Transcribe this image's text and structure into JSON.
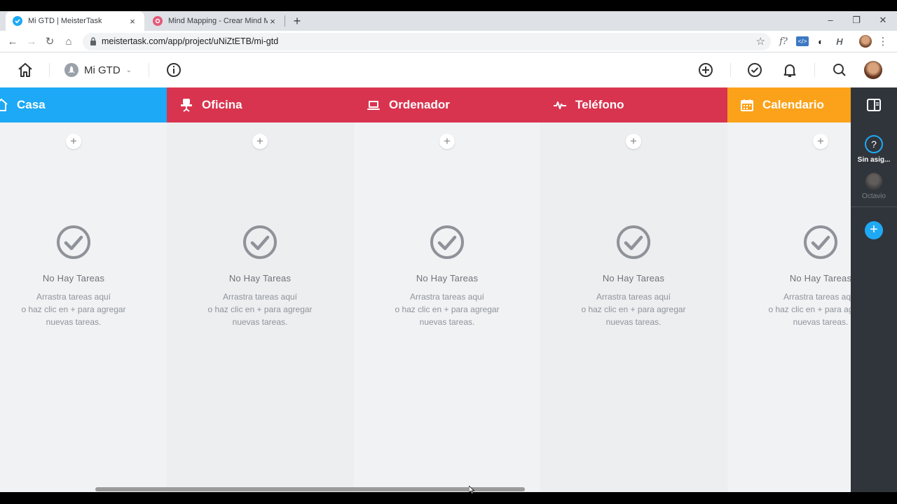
{
  "browser": {
    "tabs": [
      {
        "title": "Mi GTD | MeisterTask",
        "close": "×",
        "favicon_color": "#1fa9f4"
      },
      {
        "title": "Mind Mapping - Crear Mind Map",
        "close": "×",
        "favicon_color": "#e35a7a"
      }
    ],
    "new_tab": "+",
    "window_controls": {
      "minimize": "–",
      "maximize": "❐",
      "close": "✕"
    },
    "nav": {
      "back": "←",
      "forward": "→",
      "reload": "↻",
      "home": "⌂"
    },
    "url": "meistertask.com/app/project/uNiZtETB/mi-gtd",
    "star": "☆",
    "extensions": {
      "formula": "f?",
      "script": "</>",
      "dark": "◐",
      "h": "H",
      "menu": "⋮"
    }
  },
  "app": {
    "project_name": "Mi GTD",
    "project_chevron": "⌄",
    "icons": [
      "home-icon",
      "info-icon",
      "add-circle-icon",
      "check-circle-icon",
      "bell-icon",
      "search-icon"
    ]
  },
  "board": {
    "sections": [
      {
        "name": "Casa",
        "color": "#1da9f5",
        "icon": "home-icon"
      },
      {
        "name": "Oficina",
        "color": "#d9344f",
        "icon": "chair-icon"
      },
      {
        "name": "Ordenador",
        "color": "#d9344f",
        "icon": "laptop-icon"
      },
      {
        "name": "Teléfono",
        "color": "#d9344f",
        "icon": "pulse-icon"
      },
      {
        "name": "Calendario",
        "color": "#fba21a",
        "icon": "calendar-icon"
      }
    ],
    "add_label": "+",
    "empty_title": "No Hay Tareas",
    "empty_text": "Arrastra tareas aquí\no haz clic en + para agregar\nnuevas tareas."
  },
  "rail": {
    "unassigned_symbol": "?",
    "unassigned_label": "Sin asig...",
    "user_label": "Octavio",
    "add_label": "+",
    "accent": "#1fa9f4"
  }
}
